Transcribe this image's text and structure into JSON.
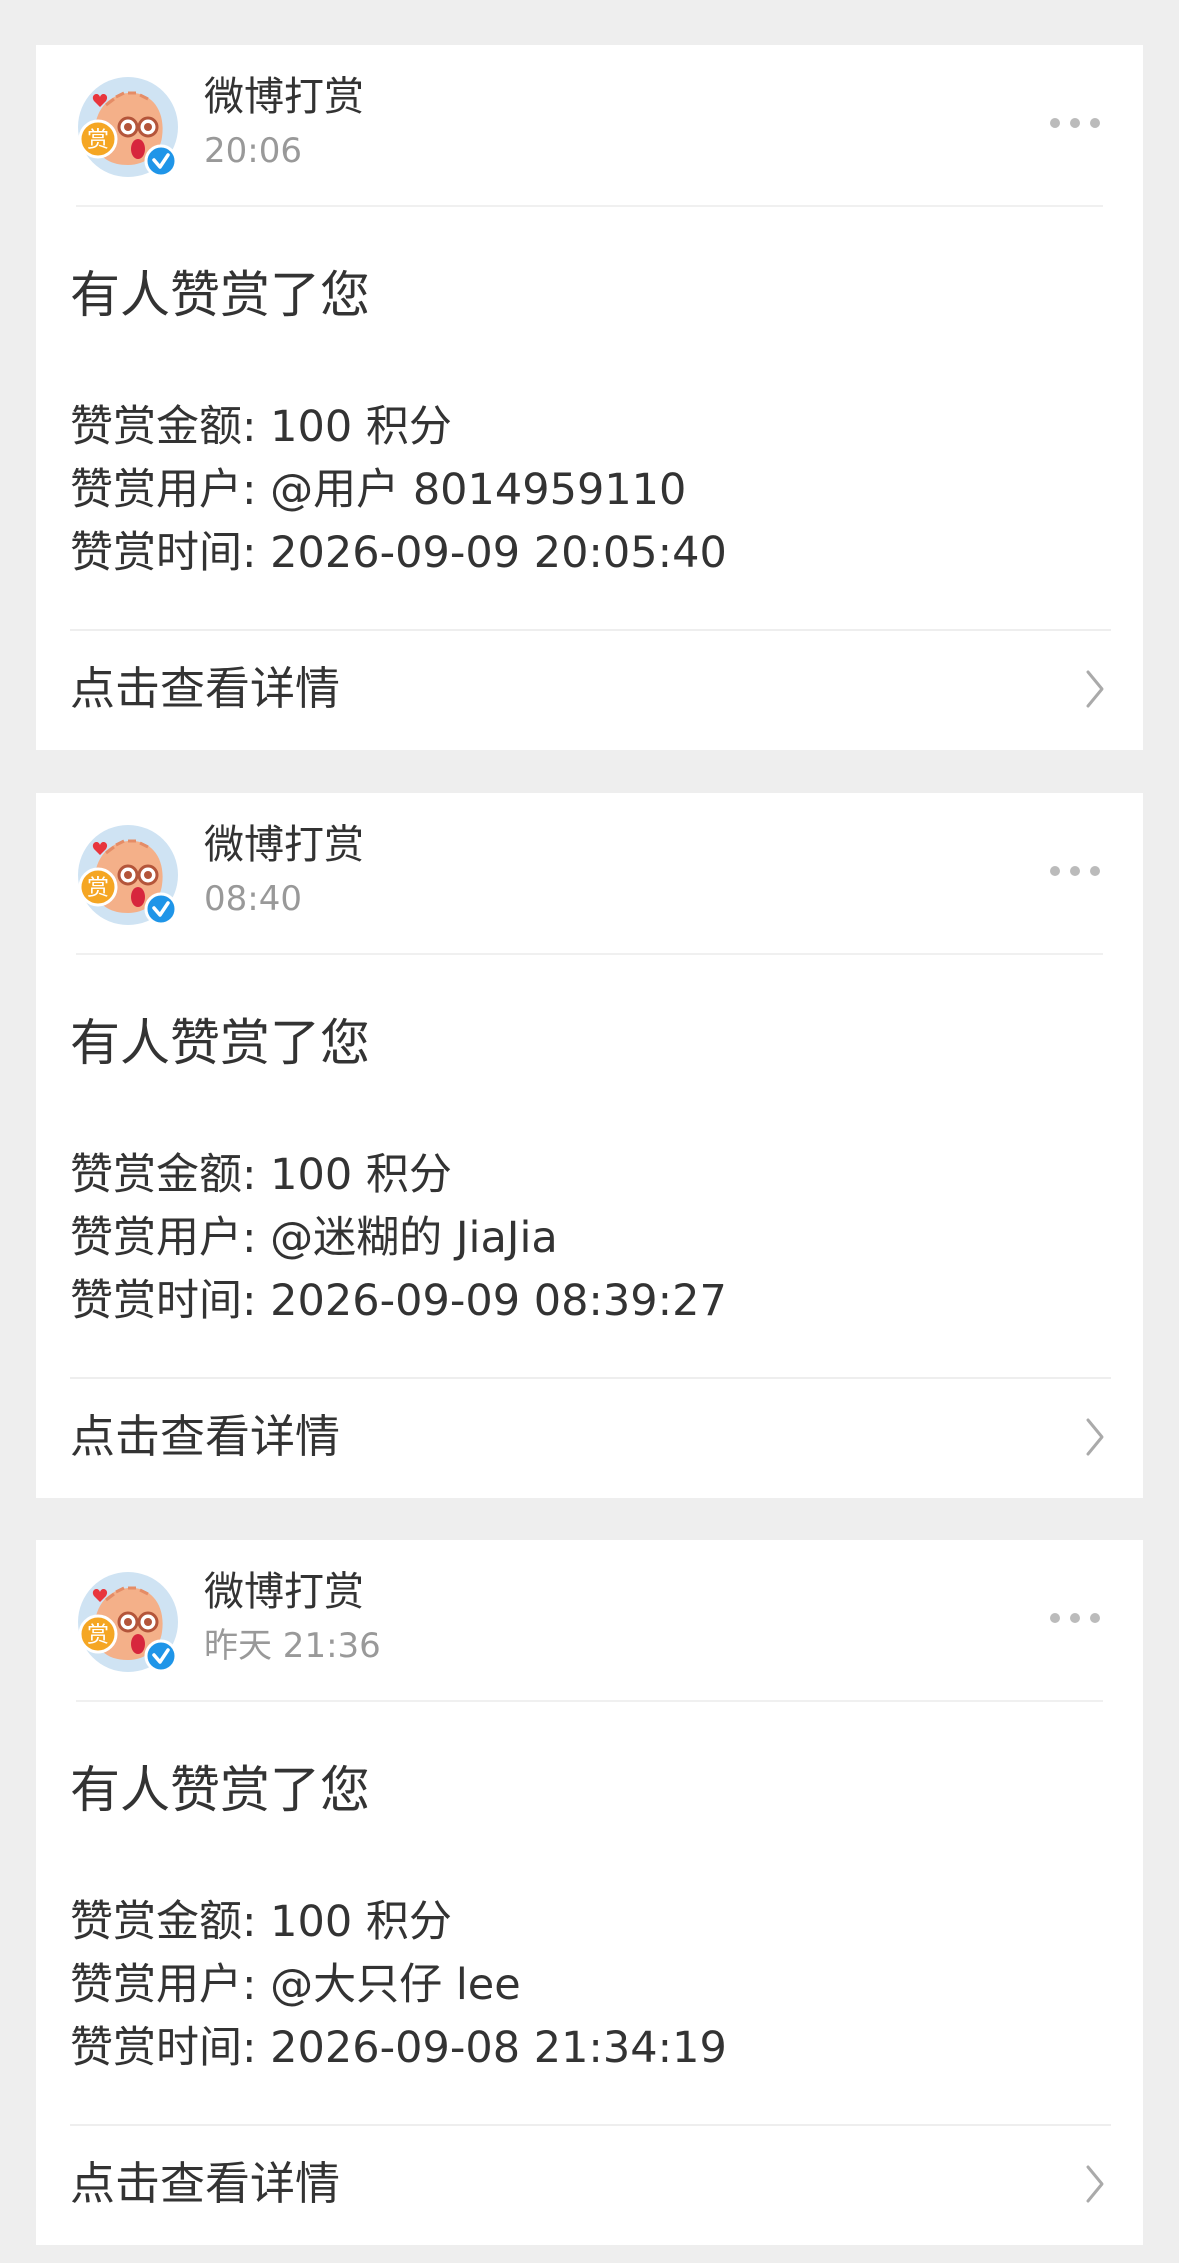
{
  "notifications": [
    {
      "sender": "微博打赏",
      "time": "20:06",
      "title": "有人赞赏了您",
      "amount_line": "赞赏金额: 100 积分",
      "user_line": "赞赏用户: @用户 8014959110",
      "time_line": "赞赏时间: 2026-09-09 20:05:40",
      "link_label": "点击查看详情"
    },
    {
      "sender": "微博打赏",
      "time": "08:40",
      "title": "有人赞赏了您",
      "amount_line": "赞赏金额: 100 积分",
      "user_line": "赞赏用户: @迷糊的 JiaJia",
      "time_line": "赞赏时间: 2026-09-09 08:39:27",
      "link_label": "点击查看详情"
    },
    {
      "sender": "微博打赏",
      "time": "昨天 21:36",
      "title": "有人赞赏了您",
      "amount_line": "赞赏金额: 100 积分",
      "user_line": "赞赏用户: @大只仔 lee",
      "time_line": "赞赏时间: 2026-09-08 21:34:19",
      "link_label": "点击查看详情"
    }
  ],
  "avatar": {
    "badge_text": "赏",
    "badge_color": "#f5a623",
    "face_color": "#f4b089",
    "background_color": "#cfe3f3",
    "heart_color": "#e8353d",
    "verified_color": "#1f95e8"
  },
  "icons": {
    "more": "more-dots-icon",
    "chevron": "chevron-right-icon",
    "verified": "verified-badge-icon"
  },
  "colors": {
    "page_background": "#eeeeee",
    "card_background": "#ffffff",
    "primary_text": "#333333",
    "secondary_text": "#999999"
  }
}
